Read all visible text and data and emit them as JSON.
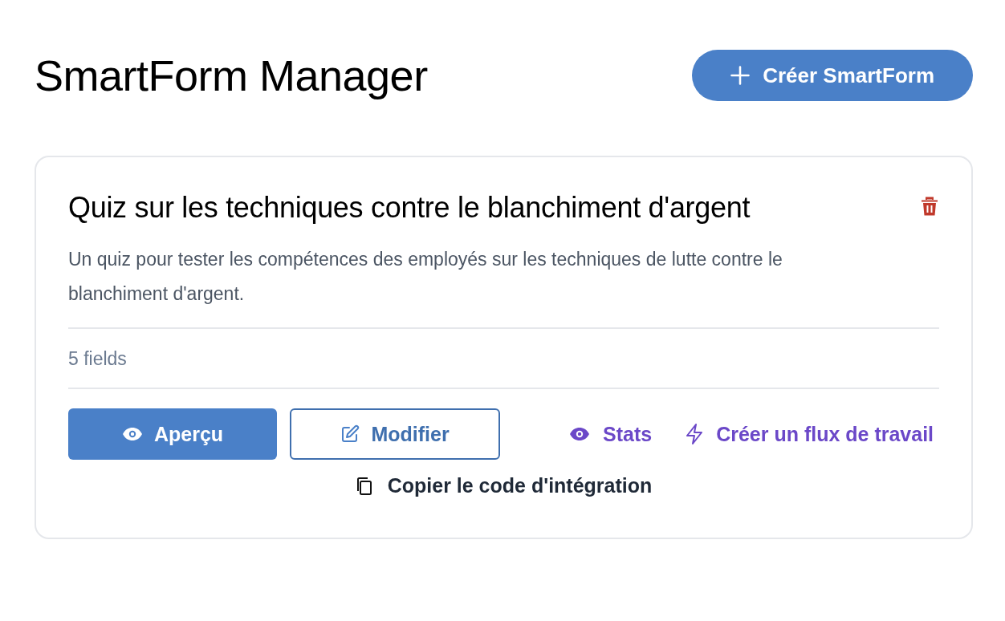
{
  "header": {
    "title": "SmartForm Manager",
    "create_button": "Créer SmartForm"
  },
  "forms": [
    {
      "title": "Quiz sur les techniques contre le blanchiment d'argent",
      "description": "Un quiz pour tester les compétences des employés sur les techniques de lutte contre le blanchiment d'argent.",
      "field_count": "5 fields",
      "actions": [
        {
          "kind": "primary",
          "label": "Aperçu"
        },
        {
          "kind": "outline",
          "label": "Modifier"
        },
        {
          "kind": "link",
          "label": "Stats"
        },
        {
          "kind": "link",
          "label": "Créer un flux de travail"
        }
      ],
      "copy_label": "Copier le code d'intégration"
    }
  ]
}
